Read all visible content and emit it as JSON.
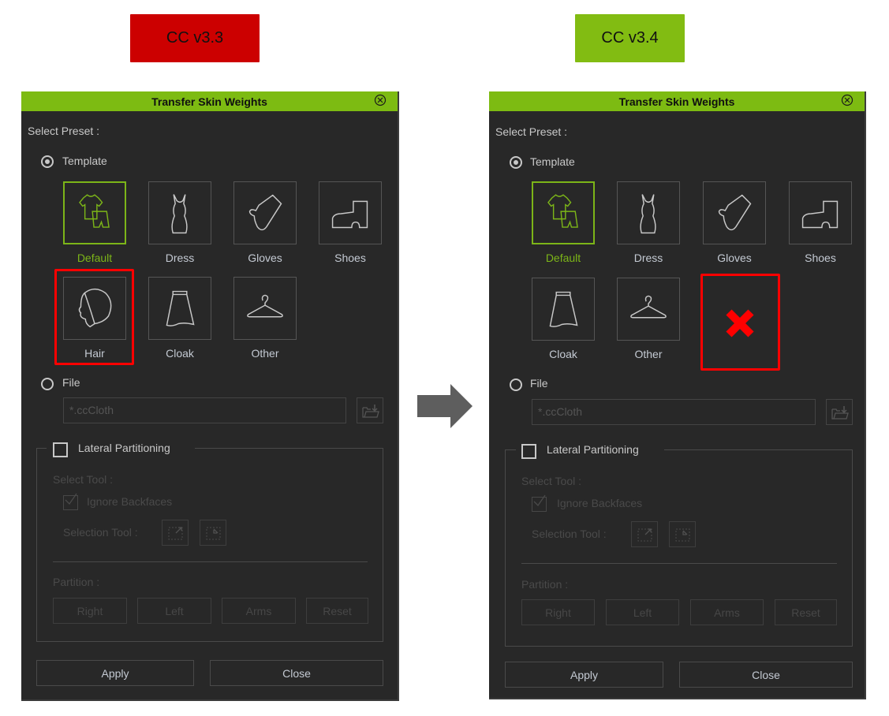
{
  "comparison": {
    "left_version": "CC v3.3",
    "right_version": "CC v3.4",
    "left_version_color": "#cc0000",
    "right_version_color": "#82bc12",
    "arrow_icon": "arrow-right-icon",
    "highlight_color": "#ff0000",
    "removed_marker_icon": "red-x-icon"
  },
  "dialogs": [
    {
      "title": "Transfer Skin Weights",
      "select_preset_label": "Select Preset :",
      "template_label": "Template",
      "template_selected": true,
      "presets": [
        {
          "label": "Default",
          "icon": "outfit-icon",
          "selected": true
        },
        {
          "label": "Dress",
          "icon": "dress-icon",
          "selected": false
        },
        {
          "label": "Gloves",
          "icon": "glove-icon",
          "selected": false
        },
        {
          "label": "Shoes",
          "icon": "boot-icon",
          "selected": false
        },
        {
          "label": "Hair",
          "icon": "hair-icon",
          "selected": false,
          "highlighted": true
        },
        {
          "label": "Cloak",
          "icon": "skirt-icon",
          "selected": false
        },
        {
          "label": "Other",
          "icon": "hanger-icon",
          "selected": false
        }
      ],
      "file_label": "File",
      "file_selected": false,
      "file_placeholder": "*.ccCloth",
      "lateral_partitioning": {
        "label": "Lateral Partitioning",
        "checked": false,
        "select_tool_label": "Select Tool :",
        "ignore_backfaces_label": "Ignore Backfaces",
        "ignore_backfaces_checked": true,
        "selection_tool_label": "Selection Tool :",
        "partition_label": "Partition :",
        "partition_buttons": [
          "Right",
          "Left",
          "Arms",
          "Reset"
        ]
      },
      "apply_label": "Apply",
      "close_label": "Close"
    },
    {
      "title": "Transfer Skin Weights",
      "select_preset_label": "Select Preset :",
      "template_label": "Template",
      "template_selected": true,
      "presets": [
        {
          "label": "Default",
          "icon": "outfit-icon",
          "selected": true
        },
        {
          "label": "Dress",
          "icon": "dress-icon",
          "selected": false
        },
        {
          "label": "Gloves",
          "icon": "glove-icon",
          "selected": false
        },
        {
          "label": "Shoes",
          "icon": "boot-icon",
          "selected": false
        },
        {
          "label": "Cloak",
          "icon": "skirt-icon",
          "selected": false
        },
        {
          "label": "Other",
          "icon": "hanger-icon",
          "selected": false
        }
      ],
      "removed_preset_marker": true,
      "file_label": "File",
      "file_selected": false,
      "file_placeholder": "*.ccCloth",
      "lateral_partitioning": {
        "label": "Lateral Partitioning",
        "checked": false,
        "select_tool_label": "Select Tool :",
        "ignore_backfaces_label": "Ignore Backfaces",
        "ignore_backfaces_checked": true,
        "selection_tool_label": "Selection Tool :",
        "partition_label": "Partition :",
        "partition_buttons": [
          "Right",
          "Left",
          "Arms",
          "Reset"
        ]
      },
      "apply_label": "Apply",
      "close_label": "Close"
    }
  ]
}
